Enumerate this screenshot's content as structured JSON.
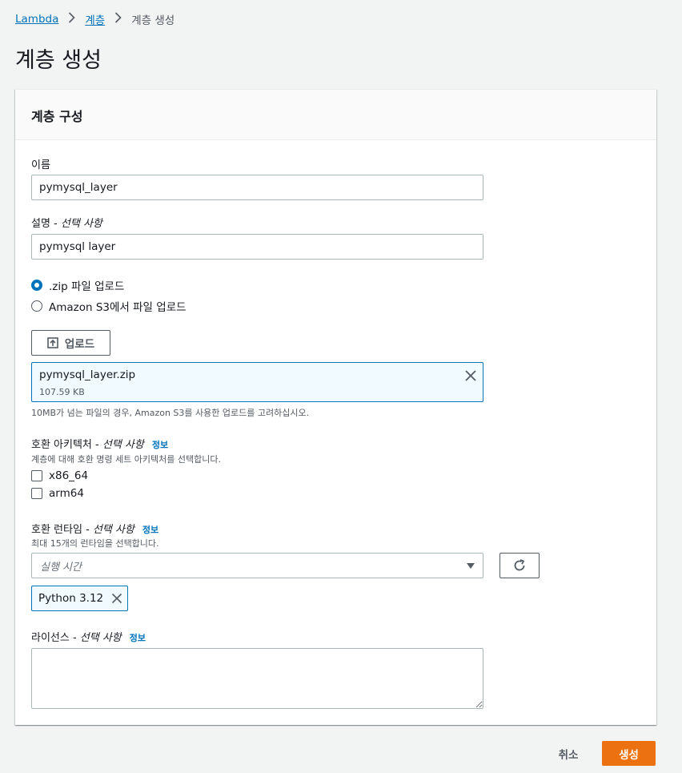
{
  "breadcrumb": {
    "items": [
      "Lambda",
      "계층",
      "계층 생성"
    ]
  },
  "page": {
    "title": "계층 생성"
  },
  "panel": {
    "title": "계층 구성"
  },
  "form": {
    "name": {
      "label": "이름",
      "value": "pymysql_layer"
    },
    "description": {
      "label": "설명 - ",
      "optional": "선택 사항",
      "value": "pymysql layer"
    },
    "upload_source": {
      "options": [
        {
          "label": ".zip 파일 업로드",
          "selected": true
        },
        {
          "label": "Amazon S3에서 파일 업로드",
          "selected": false
        }
      ]
    },
    "upload_button": "업로드",
    "file": {
      "name": "pymysql_layer.zip",
      "size": "107.59 KB"
    },
    "file_hint": "10MB가 넘는 파일의 경우, Amazon S3를 사용한 업로드를 고려하십시오.",
    "architectures": {
      "label": "호환 아키텍처 - ",
      "optional": "선택 사항",
      "info": "정보",
      "description": "계층에 대해 호환 명령 세트 아키텍처를 선택합니다.",
      "options": [
        {
          "label": "x86_64",
          "checked": false
        },
        {
          "label": "arm64",
          "checked": false
        }
      ]
    },
    "runtimes": {
      "label": "호환 런타임 - ",
      "optional": "선택 사항",
      "info": "정보",
      "description": "최대 15개의 런타임을 선택합니다.",
      "placeholder": "실행 시간",
      "selected": [
        "Python 3.12"
      ]
    },
    "license": {
      "label": "라이선스 - ",
      "optional": "선택 사항",
      "info": "정보",
      "value": ""
    }
  },
  "actions": {
    "cancel": "취소",
    "create": "생성"
  },
  "colors": {
    "link": "#0073bb",
    "primary_button": "#ec7211",
    "token_background": "#f1faff"
  },
  "icons": {
    "upload": "upload-icon",
    "remove": "close-icon",
    "refresh": "refresh-icon",
    "caret": "caret-down-icon",
    "separator": "chevron-right-icon"
  }
}
